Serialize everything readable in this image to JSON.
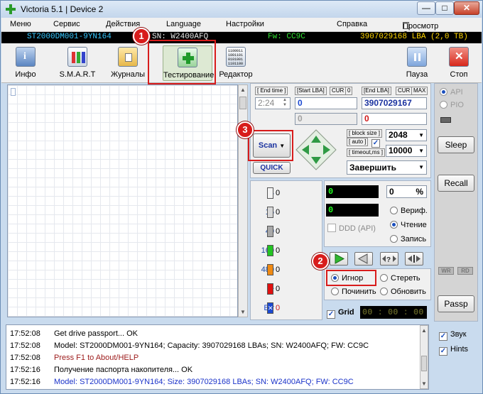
{
  "window": {
    "title": "Victoria 5.1 | Device 2",
    "controls": [
      "—",
      "□",
      "✕"
    ]
  },
  "menu": [
    "Меню",
    "Сервис",
    "Действия",
    "Language",
    "Настройки",
    "Справка"
  ],
  "clipboard": "Просмотр буфера",
  "drive": {
    "model": "ST2000DM001-9YN164",
    "serial": "SN: W2400AFQ",
    "firmware": "Fw: CC9C",
    "capacity": "3907029168 LBA (2,0 TB)"
  },
  "toolbar": {
    "info": "Инфо",
    "smart": "S.M.A.R.T",
    "journals": "Журналы",
    "testing": "Тестирование",
    "editor": "Редактор",
    "pause": "Пауза",
    "stop": "Стоп"
  },
  "badges": {
    "one": "1",
    "two": "2",
    "three": "3"
  },
  "scan_params": {
    "end_time_label": "[ End time ]",
    "start_lba_label": "[Start LBA]",
    "cur_label": "CUR",
    "zero_label": "0",
    "end_lba_label": "[End LBA]",
    "max_label": "MAX",
    "end_time_value": "2:24",
    "start_lba_value": "0",
    "end_lba_value": "3907029167",
    "start_lba_current": "0",
    "end_lba_current": "0",
    "block_size_label": "[ block size ]",
    "auto_label": "[ auto ]",
    "timeout_label": "[ timeout,ms ]",
    "block_size_value": "2048",
    "timeout_value": "10000",
    "scan_button": "Scan",
    "quick_button": "QUICK",
    "finish_select": "Завершить"
  },
  "blocks": [
    {
      "label": "4",
      "count": "0",
      "color": "#f4f4f4"
    },
    {
      "label": "16",
      "count": "0",
      "color": "#d8d8d8"
    },
    {
      "label": "40",
      "count": "0",
      "color": "#a9a9a9"
    },
    {
      "label": "160",
      "count": "0",
      "color": "#23c423"
    },
    {
      "label": "480",
      "count": "0",
      "color": "#f08a13"
    },
    {
      "label": ">",
      "count": "0",
      "color": "#e01010"
    },
    {
      "label": "Err",
      "count": "0",
      "color": "#1b49d1"
    }
  ],
  "progress": {
    "counter": "0",
    "percent": "0",
    "percent_sign": "%",
    "speed": "0",
    "ddd_label": "DDD (API)",
    "verify": "Вериф.",
    "read": "Чтение",
    "write": "Запись"
  },
  "actions": {
    "ignore": "Игнор",
    "erase": "Стереть",
    "repair": "Починить",
    "refresh": "Обновить",
    "grid": "Grid",
    "timer": "00 : 00 : 00"
  },
  "right_panel": {
    "api": "API",
    "pio": "PIO",
    "sleep": "Sleep",
    "recall": "Recall",
    "wr": "WR",
    "rd": "RD",
    "passp": "Passp",
    "sound": "Звук",
    "hints": "Hints"
  },
  "log": [
    {
      "time": "17:52:08",
      "text": "Get drive passport... OK",
      "color": "#000000"
    },
    {
      "time": "17:52:08",
      "text": "Model: ST2000DM001-9YN164; Capacity: 3907029168 LBAs; SN: W2400AFQ; FW: CC9C",
      "color": "#000000"
    },
    {
      "time": "17:52:08",
      "text": "Press F1 to About/HELP",
      "color": "#9c1a1a"
    },
    {
      "time": "17:52:16",
      "text": "Получение паспорта накопителя... OK",
      "color": "#000000"
    },
    {
      "time": "17:52:16",
      "text": "Model: ST2000DM001-9YN164; Size: 3907029168 LBAs; SN: W2400AFQ; FW: CC9C",
      "color": "#1b33c9"
    }
  ]
}
